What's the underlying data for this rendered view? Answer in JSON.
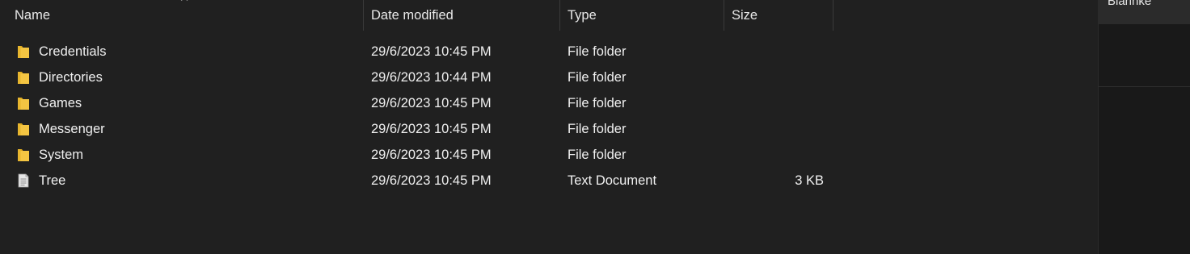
{
  "columns": {
    "name": "Name",
    "date_modified": "Date modified",
    "type": "Type",
    "size": "Size"
  },
  "right_pane": {
    "header_text": "Blahnke"
  },
  "files": [
    {
      "icon": "folder-icon",
      "name": "Credentials",
      "date": "29/6/2023 10:45 PM",
      "type": "File folder",
      "size": ""
    },
    {
      "icon": "folder-icon",
      "name": "Directories",
      "date": "29/6/2023 10:44 PM",
      "type": "File folder",
      "size": ""
    },
    {
      "icon": "folder-icon",
      "name": "Games",
      "date": "29/6/2023 10:45 PM",
      "type": "File folder",
      "size": ""
    },
    {
      "icon": "folder-icon",
      "name": "Messenger",
      "date": "29/6/2023 10:45 PM",
      "type": "File folder",
      "size": ""
    },
    {
      "icon": "folder-icon",
      "name": "System",
      "date": "29/6/2023 10:45 PM",
      "type": "File folder",
      "size": ""
    },
    {
      "icon": "text-document-icon",
      "name": "Tree",
      "date": "29/6/2023 10:45 PM",
      "type": "Text Document",
      "size": "3 KB"
    }
  ],
  "colors": {
    "pane_background": "#202020",
    "text": "#f0f0f0",
    "folder_yellow": "#f4c542",
    "folder_yellow_dark": "#d9a51c",
    "document_white": "#e6e6e6"
  }
}
